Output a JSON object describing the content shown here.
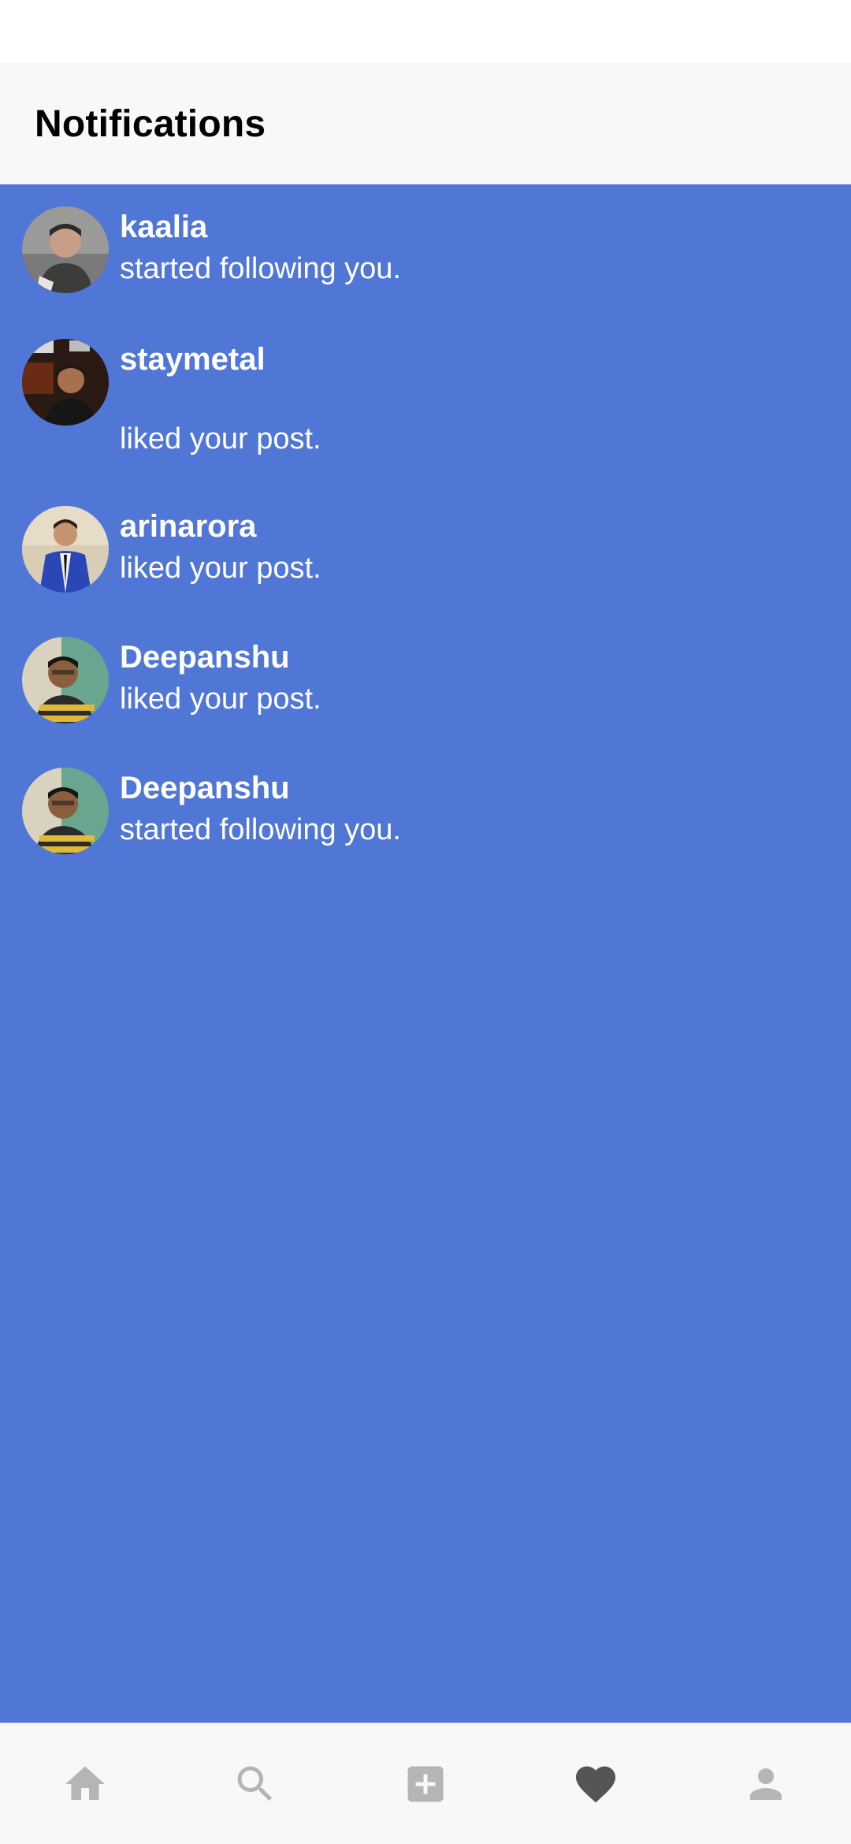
{
  "header": {
    "title": "Notifications"
  },
  "colors": {
    "feed_background": "#5076d6",
    "header_background": "#f8f8f8",
    "nav_inactive": "#b5b5b5",
    "nav_active": "#555555"
  },
  "notifications": [
    {
      "username": "kaalia",
      "action": "started following you.",
      "avatar": "avatar-kaalia"
    },
    {
      "username": "staymetal",
      "action": "liked your post.",
      "avatar": "avatar-staymetal"
    },
    {
      "username": "arinarora",
      "action": "liked your post.",
      "avatar": "avatar-arinarora"
    },
    {
      "username": "Deepanshu",
      "action": "liked your post.",
      "avatar": "avatar-deepanshu"
    },
    {
      "username": "Deepanshu",
      "action": "started following you.",
      "avatar": "avatar-deepanshu"
    }
  ],
  "bottom_nav": [
    {
      "name": "home",
      "icon": "home-icon",
      "active": false
    },
    {
      "name": "search",
      "icon": "search-icon",
      "active": false
    },
    {
      "name": "add-post",
      "icon": "add-box-icon",
      "active": false
    },
    {
      "name": "activity",
      "icon": "heart-icon",
      "active": true
    },
    {
      "name": "profile",
      "icon": "person-icon",
      "active": false
    }
  ]
}
